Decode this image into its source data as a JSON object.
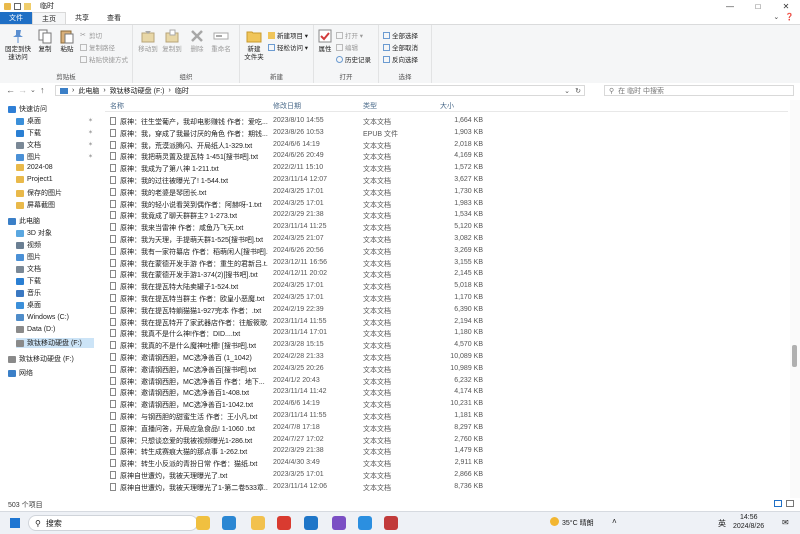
{
  "window": {
    "title": "临时",
    "controls": [
      "minimize",
      "maximize",
      "close"
    ]
  },
  "tabs": [
    {
      "label": "文件"
    },
    {
      "label": "主页"
    },
    {
      "label": "共享"
    },
    {
      "label": "查看"
    }
  ],
  "ribbon": {
    "clipboard": {
      "pin_label": "固定到快\n速访问",
      "copy_label": "复制",
      "paste_label": "粘贴",
      "cut_label": "剪切",
      "copy_path_label": "复制路径",
      "paste_shortcut_label": "粘贴快捷方式",
      "group_label": "剪贴板"
    },
    "organize": {
      "move_to_label": "移动到",
      "copy_to_label": "复制到",
      "delete_label": "删除",
      "rename_label": "重命名",
      "group_label": "组织"
    },
    "new": {
      "new_folder_label": "新建\n文件夹",
      "new_item_label": "新建项目 ▾",
      "easy_access_label": "轻松访问 ▾",
      "group_label": "新建"
    },
    "open": {
      "properties_label": "属性",
      "open_label": "打开 ▾",
      "edit_label": "编辑",
      "history_label": "历史记录",
      "group_label": "打开"
    },
    "select": {
      "select_all_label": "全部选择",
      "select_none_label": "全部取消",
      "invert_label": "反向选择",
      "group_label": "选择"
    }
  },
  "address": {
    "crumbs": [
      "此电脑",
      "致钛移动硬盘 (F:)",
      "临时"
    ],
    "search_placeholder": "在 临时 中搜索"
  },
  "nav": {
    "items": [
      {
        "label": "快速访问",
        "icon": "star-icon",
        "color": "#2f7fd6"
      },
      {
        "label": "桌面",
        "icon": "desktop-icon",
        "color": "#3b8fd9",
        "pinned": true
      },
      {
        "label": "下载",
        "icon": "download-icon",
        "color": "#2a7fd3",
        "pinned": true
      },
      {
        "label": "文档",
        "icon": "document-icon",
        "color": "#7a8896",
        "pinned": true
      },
      {
        "label": "图片",
        "icon": "pictures-icon",
        "color": "#4a90d6",
        "pinned": true
      },
      {
        "label": "2024-08",
        "icon": "folder-icon",
        "color": "#e9b94a"
      },
      {
        "label": "Project1",
        "icon": "folder-icon",
        "color": "#e9b94a"
      },
      {
        "label": "保存的图片",
        "icon": "folder-icon",
        "color": "#e9b94a"
      },
      {
        "label": "屏幕截图",
        "icon": "folder-icon",
        "color": "#e9b94a"
      },
      {
        "label": "此电脑",
        "icon": "pc-icon",
        "color": "#3b7fc7"
      },
      {
        "label": "3D 对象",
        "icon": "cube-icon",
        "color": "#5aa7e0"
      },
      {
        "label": "视频",
        "icon": "video-icon",
        "color": "#6a7f93"
      },
      {
        "label": "图片",
        "icon": "pictures-icon",
        "color": "#4a90d6"
      },
      {
        "label": "文档",
        "icon": "document-icon",
        "color": "#7a8896"
      },
      {
        "label": "下载",
        "icon": "download-icon",
        "color": "#2a7fd3"
      },
      {
        "label": "音乐",
        "icon": "music-icon",
        "color": "#3a78c2"
      },
      {
        "label": "桌面",
        "icon": "desktop-icon",
        "color": "#3b8fd9"
      },
      {
        "label": "Windows (C:)",
        "icon": "drive-icon",
        "color": "#4f8cc9"
      },
      {
        "label": "Data (D:)",
        "icon": "drive-icon",
        "color": "#8a8a8a"
      },
      {
        "label": "致钛移动硬盘 (F:)",
        "icon": "drive-icon",
        "color": "#8a8a8a",
        "selected": true
      },
      {
        "label": "致钛移动硬盘 (F:)",
        "icon": "drive-icon",
        "color": "#8a8a8a"
      },
      {
        "label": "网络",
        "icon": "network-icon",
        "color": "#3b7fc7"
      }
    ]
  },
  "columns": {
    "name": "名称",
    "date": "修改日期",
    "type": "类型",
    "size": "大小"
  },
  "files": [
    {
      "name": "原神：往生堂葡产，我却电影赚钱 作者：爱吃...",
      "date": "2023/8/10 14:55",
      "type": "文本文档",
      "size": "1,664 KB"
    },
    {
      "name": "原神：我，穿成了我最讨厌的角色 作者：期钱...",
      "date": "2023/8/26 10:53",
      "type": "EPUB 文件",
      "size": "1,903 KB"
    },
    {
      "name": "原神：我，荒漠派腾闪、开局纸人1-329.txt",
      "date": "2024/6/6 14:19",
      "type": "文本文档",
      "size": "2,018 KB"
    },
    {
      "name": "原神：我把萌灵置及提瓦特 1-451[搜书吧].txt",
      "date": "2024/6/26 20:49",
      "type": "文本文档",
      "size": "4,169 KB"
    },
    {
      "name": "原神：我成为了第八神 1-211.txt",
      "date": "2022/2/11 15:10",
      "type": "文本文档",
      "size": "1,572 KB"
    },
    {
      "name": "原神：我的过往被曝光了! 1-544.txt",
      "date": "2023/11/14 12:07",
      "type": "文本文档",
      "size": "3,627 KB"
    },
    {
      "name": "原神：我的老婆是琴团长.txt",
      "date": "2024/3/25 17:01",
      "type": "文本文档",
      "size": "1,730 KB"
    },
    {
      "name": "原神：我的轻小说看哭到偶作者：阿赫呀-1.txt",
      "date": "2024/3/25 17:01",
      "type": "文本文档",
      "size": "1,983 KB"
    },
    {
      "name": "原神：我竟成了聊天群群主? 1-273.txt",
      "date": "2022/3/29 21:38",
      "type": "文本文档",
      "size": "1,534 KB"
    },
    {
      "name": "原神：我来当雷神 作者：咸鱼乃飞天.txt",
      "date": "2023/11/14 11:25",
      "type": "文本文档",
      "size": "5,120 KB"
    },
    {
      "name": "原神：我为天理，手提萌天群1-525[搜书吧].txt",
      "date": "2024/3/25 21:07",
      "type": "文本文档",
      "size": "3,082 KB"
    },
    {
      "name": "原神：我有一家符纂店 作者：稻萌闲人[搜书吧].txt",
      "date": "2024/6/26 20:56",
      "type": "文本文档",
      "size": "3,269 KB"
    },
    {
      "name": "原神：我在蒙德开发手游 作者：重生的君新吕.t...",
      "date": "2023/12/11 16:56",
      "type": "文本文档",
      "size": "3,155 KB"
    },
    {
      "name": "原神：我在蒙德开发手游1-374(2)[搜书吧].txt",
      "date": "2024/12/11 20:02",
      "type": "文本文档",
      "size": "2,145 KB"
    },
    {
      "name": "原神：我在提瓦特大陆卖罐子1-524.txt",
      "date": "2024/3/25 17:01",
      "type": "文本文档",
      "size": "5,018 KB"
    },
    {
      "name": "原神：我在提瓦特当群主 作者：欧皇小恶魔.txt",
      "date": "2024/3/25 17:01",
      "type": "文本文档",
      "size": "1,170 KB"
    },
    {
      "name": "原神：我在提瓦特躺猫猫1-927完本 作者：.txt",
      "date": "2024/2/19 22:39",
      "type": "文本文档",
      "size": "6,390 KB"
    },
    {
      "name": "原神：我在提瓦特开了家武器店作者：往舨筱歌...",
      "date": "2023/11/14 11:55",
      "type": "文本文档",
      "size": "2,194 KB"
    },
    {
      "name": "原神：我真不是什么神!作者：DID....txt",
      "date": "2023/11/14 17:01",
      "type": "文本文档",
      "size": "1,180 KB"
    },
    {
      "name": "原神：我真的不是什么魔神吐槽! [搜书吧].txt",
      "date": "2023/3/28 15:15",
      "type": "文本文档",
      "size": "4,570 KB"
    },
    {
      "name": "原神：邀请钢西胆，MC选净善百 (1_1042)",
      "date": "2024/2/28 21:33",
      "type": "文本文档",
      "size": "10,089 KB"
    },
    {
      "name": "原神：邀请钢西胆，MC选净善百[搜书吧].txt",
      "date": "2024/3/25 20:26",
      "type": "文本文档",
      "size": "10,989 KB"
    },
    {
      "name": "原神：邀请钢西胆，MC选净善百 作者：地下...",
      "date": "2024/1/2 20:43",
      "type": "文本文档",
      "size": "6,232 KB"
    },
    {
      "name": "原神：邀请钢西胆，MC选净善百1-408.txt",
      "date": "2023/11/14 11:42",
      "type": "文本文档",
      "size": "4,174 KB"
    },
    {
      "name": "原神：邀请钢西胆，MC选净善百1-1042.txt",
      "date": "2024/6/6 14:19",
      "type": "文本文档",
      "size": "10,231 KB"
    },
    {
      "name": "原神：与钢西胆的甜蜜生活 作者：王小凡.txt",
      "date": "2023/11/14 11:55",
      "type": "文本文档",
      "size": "1,181 KB"
    },
    {
      "name": "原神：直播问答，开局应急食品! 1-1060 .txt",
      "date": "2024/7/8 17:18",
      "type": "文本文档",
      "size": "8,297 KB"
    },
    {
      "name": "原神：只想谈恋爱的我被视频曝光1-286.txt",
      "date": "2024/7/27 17:02",
      "type": "文本文档",
      "size": "2,760 KB"
    },
    {
      "name": "原神：转生成赛痕大猫的那点事 1-262.txt",
      "date": "2022/3/29 21:38",
      "type": "文本文档",
      "size": "1,479 KB"
    },
    {
      "name": "原神：转生小反派的青扮日常 作者：猫纸.txt",
      "date": "2024/4/30 3:49",
      "type": "文本文档",
      "size": "2,911 KB"
    },
    {
      "name": "原神自世遭灼，我被天理曝光了.txt",
      "date": "2023/3/25 17:01",
      "type": "文本文档",
      "size": "2,866 KB"
    },
    {
      "name": "原神自世遭灼，我被天理曝光了1-第二卷533章...",
      "date": "2023/11/14 12:06",
      "type": "文本文档",
      "size": "8,736 KB"
    }
  ],
  "status": {
    "count": "503 个项目"
  },
  "taskbar": {
    "search_label": "搜索",
    "weather": "35°C  晴朗",
    "ime": "英",
    "time": "14:56",
    "date": "2024/8/26",
    "apps": [
      {
        "icon": "explorer-icon",
        "color": "#f0c040"
      },
      {
        "icon": "edge-icon",
        "color": "#2b87d3"
      },
      {
        "icon": "folder-icon",
        "color": "#f2c14e"
      },
      {
        "icon": "chrome-icon",
        "color": "#d93b30"
      },
      {
        "icon": "mail-icon",
        "color": "#1f76c8"
      },
      {
        "icon": "vs-icon",
        "color": "#7b4fc4"
      },
      {
        "icon": "tools-icon",
        "color": "#2b8fe0"
      },
      {
        "icon": "photo-icon",
        "color": "#c13b3b"
      }
    ]
  }
}
